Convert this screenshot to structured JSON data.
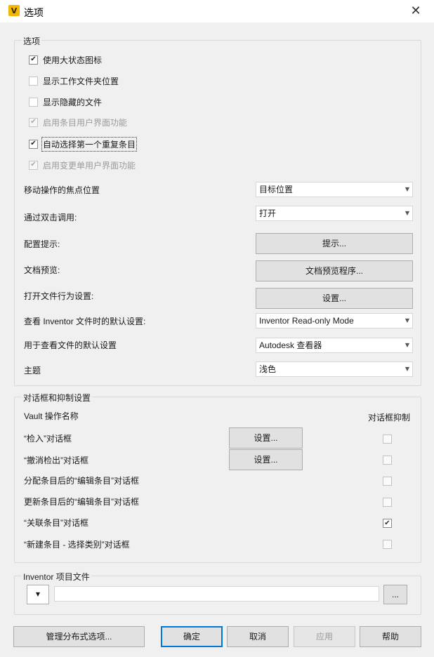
{
  "window": {
    "title": "选项",
    "app_icon_text": "V"
  },
  "options_group": {
    "title": "选项",
    "checkboxes": [
      {
        "label": "使用大状态图标",
        "checked": true,
        "enabled": true
      },
      {
        "label": "显示工作文件夹位置",
        "checked": false,
        "enabled": true
      },
      {
        "label": "显示隐藏的文件",
        "checked": false,
        "enabled": true
      },
      {
        "label": "启用条目用户界面功能",
        "checked": true,
        "enabled": false
      },
      {
        "label": "自动选择第一个重复条目",
        "checked": true,
        "enabled": true
      },
      {
        "label": "启用变更单用户界面功能",
        "checked": true,
        "enabled": false
      }
    ],
    "settings": [
      {
        "label": "移动操作的焦点位置",
        "value": "目标位置"
      },
      {
        "label": "通过双击调用:",
        "value": "打开"
      },
      {
        "label": "配置提示:",
        "button": "提示..."
      },
      {
        "label": "文档预览:",
        "button": "文档预览程序..."
      },
      {
        "label": "打开文件行为设置:",
        "button": "设置..."
      },
      {
        "label": "查看 Inventor 文件时的默认设置:",
        "value": "Inventor Read-only Mode"
      },
      {
        "label": "用于查看文件的默认设置",
        "value": "Autodesk 查看器"
      },
      {
        "label": "主题",
        "value": "浅色"
      }
    ]
  },
  "dialogs_group": {
    "title": "对话框和抑制设置",
    "col_name": "Vault 操作名称",
    "col_suppress": "对话框抑制",
    "rows": [
      {
        "label": "“检入”对话框",
        "button": "设置...",
        "suppressed": false
      },
      {
        "label": "“撤消检出”对话框",
        "button": "设置...",
        "suppressed": false
      },
      {
        "label": "分配条目后的“编辑条目”对话框",
        "suppressed": false
      },
      {
        "label": "更新条目后的“编辑条目”对话框",
        "suppressed": false
      },
      {
        "label": "“关联条目”对话框",
        "suppressed": true
      },
      {
        "label": "“新建条目 - 选择类别”对话框",
        "suppressed": false
      }
    ]
  },
  "project_group": {
    "title": "Inventor 项目文件",
    "path_value": "",
    "browse_label": "..."
  },
  "footer": {
    "manage_label": "管理分布式选项...",
    "ok_label": "确定",
    "cancel_label": "取消",
    "apply_label": "应用",
    "help_label": "帮助"
  },
  "icons": {
    "check": "✔",
    "close": "✕",
    "dropdown": "▼"
  }
}
